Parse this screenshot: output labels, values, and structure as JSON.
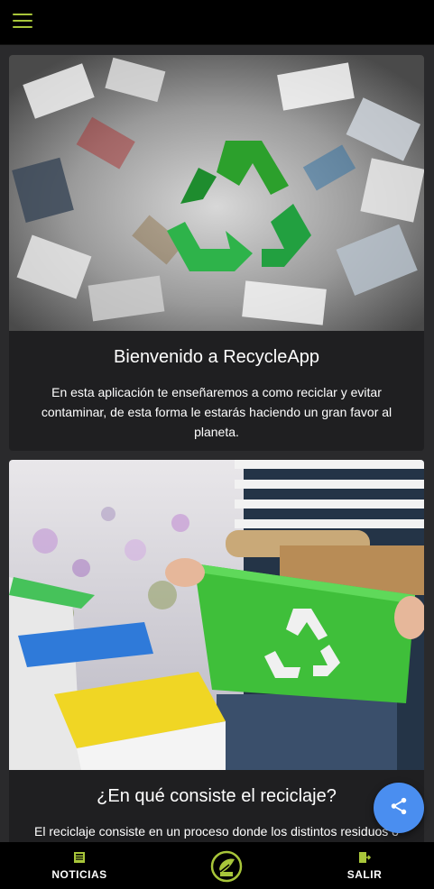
{
  "header": {
    "menu_icon": "hamburger-menu-icon",
    "accent_color": "#a8c63a"
  },
  "cards": [
    {
      "image": "recycling-symbol-paper-pile-image",
      "title": "Bienvenido a RecycleApp",
      "text": "En esta aplicación te enseñaremos a como reciclar y evitar contaminar, de esta forma le estarás haciendo un gran favor al planeta."
    },
    {
      "image": "green-recycling-box-and-bins-image",
      "title": "¿En qué consiste el reciclaje?",
      "text": "El reciclaje consiste en un proceso donde los distintos residuos o"
    }
  ],
  "fab": {
    "icon": "share-icon",
    "color": "#4a8ef0"
  },
  "bottom_nav": {
    "noticias_label": "NOTICIAS",
    "noticias_icon": "newspaper-icon",
    "center_icon": "recycle-logo-icon",
    "salir_label": "SALIR",
    "salir_icon": "exit-icon"
  }
}
